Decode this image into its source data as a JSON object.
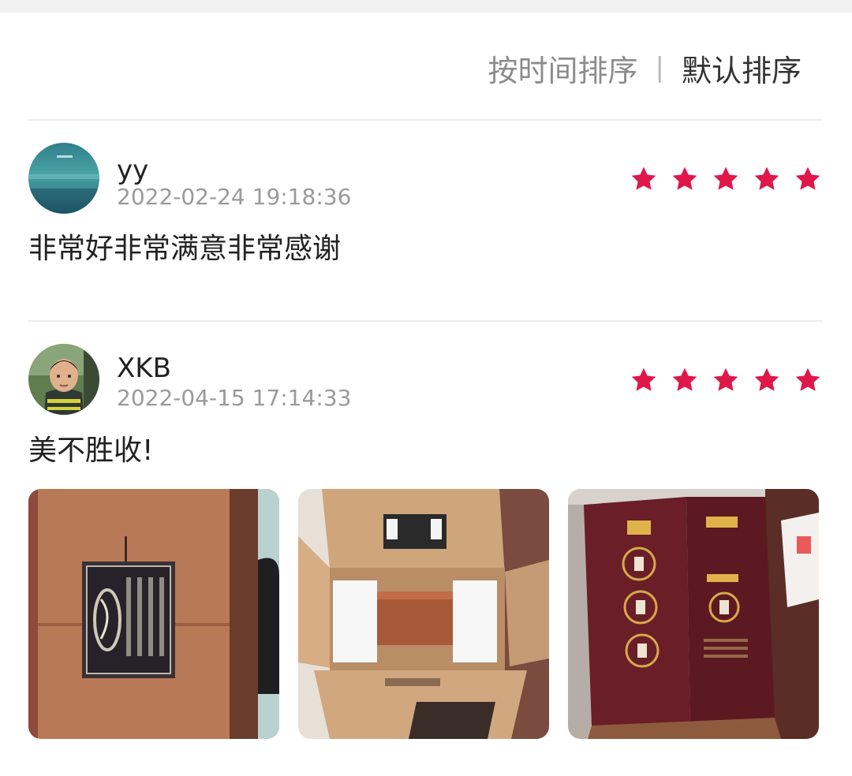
{
  "sort": {
    "by_time_label": "按时间排序",
    "separator": "|",
    "default_label": "默认排序"
  },
  "colors": {
    "star": "#e0184a",
    "sort_inactive": "#8c8c8c",
    "sort_active": "#333333"
  },
  "reviews": [
    {
      "username": "yy",
      "time": "2022-02-24 19:18:36",
      "rating": 5,
      "content": "非常好非常满意非常感谢",
      "photos": []
    },
    {
      "username": "XKB",
      "time": "2022-04-15 17:14:33",
      "rating": 5,
      "content": "美不胜收!",
      "photos": [
        "photo-plaque-on-cabinet",
        "photo-opened-shipping-box",
        "photo-open-gift-folder"
      ]
    }
  ]
}
